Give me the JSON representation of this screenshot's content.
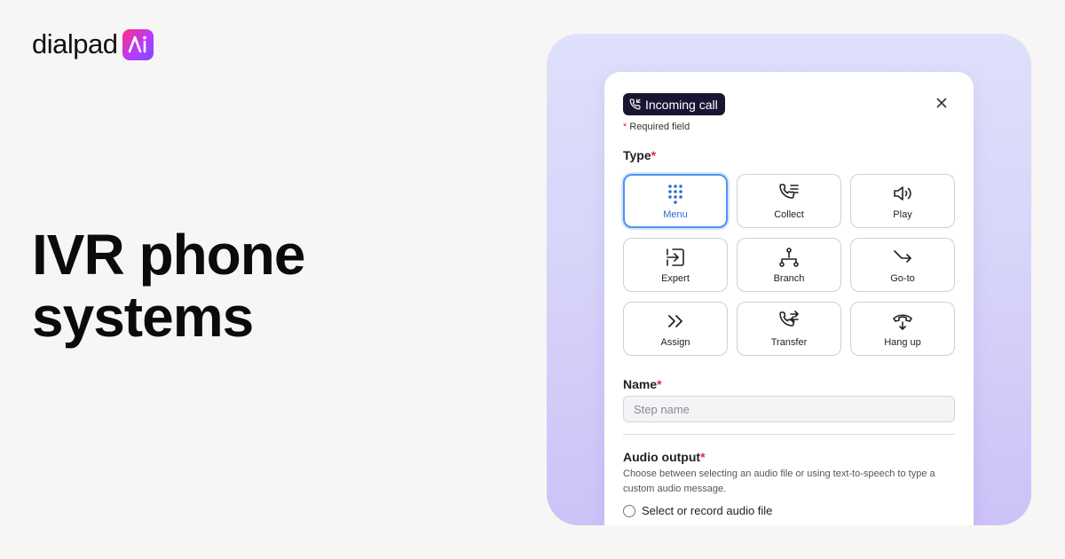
{
  "brand": {
    "logo_text": "dialpad",
    "badge_text": "Ai"
  },
  "headline": {
    "line1": "IVR phone",
    "line2": "systems"
  },
  "dialog": {
    "incoming_label": "Incoming call",
    "required_note": "Required field",
    "required_mark": "*",
    "type_label": "Type",
    "types": [
      {
        "label": "Menu",
        "icon": "keypad-icon",
        "selected": true
      },
      {
        "label": "Collect",
        "icon": "phone-list-icon",
        "selected": false
      },
      {
        "label": "Play",
        "icon": "speaker-icon",
        "selected": false
      },
      {
        "label": "Expert",
        "icon": "enter-icon",
        "selected": false
      },
      {
        "label": "Branch",
        "icon": "branch-icon",
        "selected": false
      },
      {
        "label": "Go-to",
        "icon": "goto-arrow-icon",
        "selected": false
      },
      {
        "label": "Assign",
        "icon": "double-chevron-icon",
        "selected": false
      },
      {
        "label": "Transfer",
        "icon": "phone-transfer-icon",
        "selected": false
      },
      {
        "label": "Hang up",
        "icon": "hang-up-icon",
        "selected": false
      }
    ],
    "name_label": "Name",
    "name_placeholder": "Step name",
    "audio_label": "Audio output",
    "audio_help": "Choose between selecting an audio file or using text-to-speech to type a custom audio message.",
    "audio_option_1": "Select or record audio file"
  },
  "colors": {
    "accent": "#4f93f0",
    "required": "#e0283e",
    "badge_dark": "#1b1433"
  }
}
